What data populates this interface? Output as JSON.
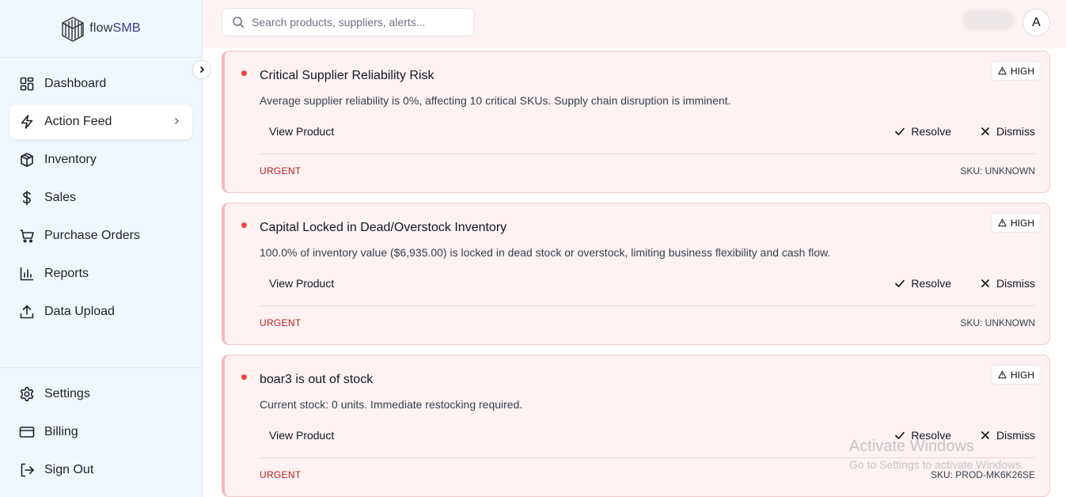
{
  "brand": {
    "name_prefix": "flow",
    "name_suffix": "SMB",
    "icon": "logo-icon"
  },
  "sidebar": {
    "items": [
      {
        "label": "Dashboard",
        "icon": "dashboard-icon"
      },
      {
        "label": "Action Feed",
        "icon": "bolt-icon",
        "active": true
      },
      {
        "label": "Inventory",
        "icon": "box-icon"
      },
      {
        "label": "Sales",
        "icon": "dollar-icon"
      },
      {
        "label": "Purchase Orders",
        "icon": "cart-icon"
      },
      {
        "label": "Reports",
        "icon": "bar-chart-icon"
      },
      {
        "label": "Data Upload",
        "icon": "upload-icon"
      }
    ],
    "bottom_items": [
      {
        "label": "Settings",
        "icon": "gear-icon"
      },
      {
        "label": "Billing",
        "icon": "credit-card-icon"
      },
      {
        "label": "Sign Out",
        "icon": "sign-out-icon"
      }
    ]
  },
  "topbar": {
    "search_placeholder": "Search products, suppliers, alerts...",
    "avatar_initial": "A"
  },
  "alerts": [
    {
      "title": "Critical Supplier Reliability Risk",
      "description": "Average supplier reliability is 0%, affecting 10 critical SKUs. Supply chain disruption is imminent.",
      "severity": "HIGH",
      "view_label": "View Product",
      "resolve_label": "Resolve",
      "dismiss_label": "Dismiss",
      "urgency": "URGENT",
      "sku": "SKU: UNKNOWN"
    },
    {
      "title": "Capital Locked in Dead/Overstock Inventory",
      "description": "100.0% of inventory value ($6,935.00) is locked in dead stock or overstock, limiting business flexibility and cash flow.",
      "severity": "HIGH",
      "view_label": "View Product",
      "resolve_label": "Resolve",
      "dismiss_label": "Dismiss",
      "urgency": "URGENT",
      "sku": "SKU: UNKNOWN"
    },
    {
      "title": "boar3 is out of stock",
      "description": "Current stock: 0 units. Immediate restocking required.",
      "severity": "HIGH",
      "view_label": "View Product",
      "resolve_label": "Resolve",
      "dismiss_label": "Dismiss",
      "urgency": "URGENT",
      "sku": "SKU: PROD-MK6K26SE"
    }
  ],
  "watermark": {
    "title": "Activate Windows",
    "subtitle": "Go to Settings to activate Windows."
  },
  "colors": {
    "accent_red": "#ef4444",
    "urgent_text": "#b91c1c",
    "card_bg": "#fdf1f1",
    "sidebar_bg": "#f0f6fd",
    "brand_blue": "#2f3e8a"
  }
}
